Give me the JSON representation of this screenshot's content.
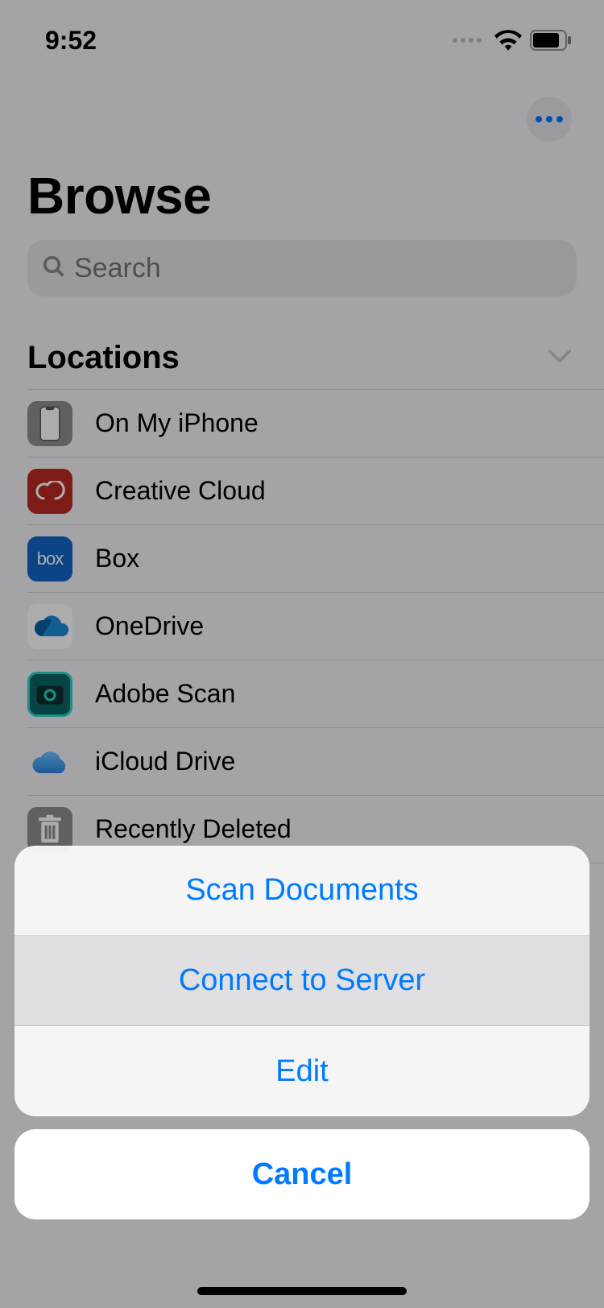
{
  "status": {
    "time": "9:52"
  },
  "header": {
    "title": "Browse"
  },
  "search": {
    "placeholder": "Search"
  },
  "section": {
    "title": "Locations"
  },
  "locations": [
    {
      "label": "On My iPhone",
      "icon": "iphone-icon"
    },
    {
      "label": "Creative Cloud",
      "icon": "creative-cloud-icon"
    },
    {
      "label": "Box",
      "icon": "box-icon"
    },
    {
      "label": "OneDrive",
      "icon": "onedrive-icon"
    },
    {
      "label": "Adobe Scan",
      "icon": "adobe-scan-icon"
    },
    {
      "label": "iCloud Drive",
      "icon": "icloud-icon"
    },
    {
      "label": "Recently Deleted",
      "icon": "trash-icon"
    }
  ],
  "sheet": {
    "items": [
      "Scan Documents",
      "Connect to Server",
      "Edit"
    ],
    "cancel": "Cancel"
  }
}
